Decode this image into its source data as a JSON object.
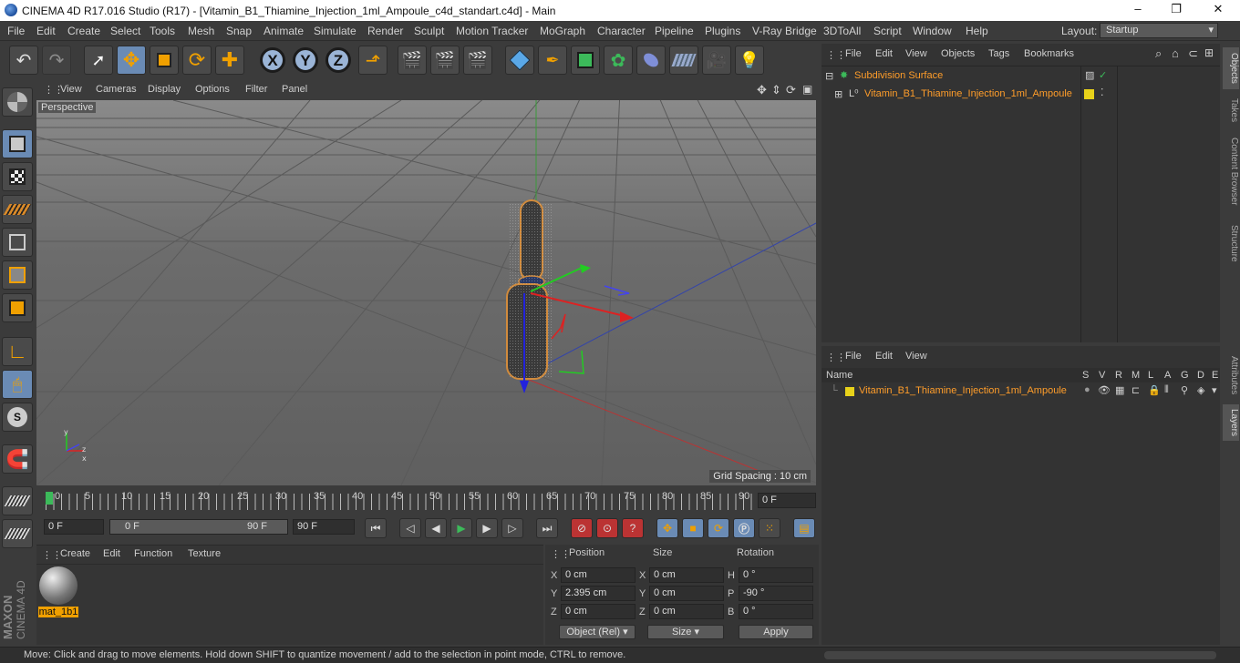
{
  "window": {
    "title": "CINEMA 4D R17.016 Studio (R17) - [Vitamin_B1_Thiamine_Injection_1ml_Ampoule_c4d_standart.c4d] - Main",
    "minimize": "–",
    "maximize": "❐",
    "close": "✕"
  },
  "menu": [
    "File",
    "Edit",
    "Create",
    "Select",
    "Tools",
    "Mesh",
    "Snap",
    "Animate",
    "Simulate",
    "Render",
    "Sculpt",
    "Motion Tracker",
    "MoGraph",
    "Character",
    "Pipeline",
    "Plugins",
    "V-Ray Bridge",
    "3DToAll",
    "Script",
    "Window",
    "Help"
  ],
  "layout": {
    "label": "Layout:",
    "value": "Startup"
  },
  "toolbar": {
    "axis_x": "X",
    "axis_y": "Y",
    "axis_z": "Z"
  },
  "viewport": {
    "menu": [
      "View",
      "Cameras",
      "Display",
      "Options",
      "Filter",
      "Panel"
    ],
    "label": "Perspective",
    "grid_spacing": "Grid Spacing : 10 cm"
  },
  "timeline": {
    "ticks": [
      "0",
      "5",
      "10",
      "15",
      "20",
      "25",
      "30",
      "35",
      "40",
      "45",
      "50",
      "55",
      "60",
      "65",
      "70",
      "75",
      "80",
      "85",
      "90"
    ],
    "frame_field": "0 F"
  },
  "playback": {
    "start": "0 F",
    "range_start": "0 F",
    "range_end": "90 F",
    "end": "90 F"
  },
  "material": {
    "menu": [
      "Create",
      "Edit",
      "Function",
      "Texture"
    ],
    "name": "mat_1b1"
  },
  "coords": {
    "headers": {
      "position": "Position",
      "size": "Size",
      "rotation": "Rotation"
    },
    "rows": [
      {
        "axis": "X",
        "pos": "0 cm",
        "size_axis": "X",
        "size": "0 cm",
        "rot_axis": "H",
        "rot": "0 °"
      },
      {
        "axis": "Y",
        "pos": "2.395 cm",
        "size_axis": "Y",
        "size": "0 cm",
        "rot_axis": "P",
        "rot": "-90 °"
      },
      {
        "axis": "Z",
        "pos": "0 cm",
        "size_axis": "Z",
        "size": "0 cm",
        "rot_axis": "B",
        "rot": "0 °"
      }
    ],
    "mode": "Object (Rel)",
    "size_mode": "Size",
    "apply": "Apply"
  },
  "objects": {
    "menu": [
      "File",
      "Edit",
      "View",
      "Objects",
      "Tags",
      "Bookmarks"
    ],
    "items": [
      {
        "name": "Subdivision Surface"
      },
      {
        "name": "Vitamin_B1_Thiamine_Injection_1ml_Ampoule"
      }
    ]
  },
  "layers": {
    "menu": [
      "File",
      "Edit",
      "View"
    ],
    "name_header": "Name",
    "cols": [
      "S",
      "V",
      "R",
      "M",
      "L",
      "A",
      "G",
      "D",
      "E"
    ],
    "item": "Vitamin_B1_Thiamine_Injection_1ml_Ampoule"
  },
  "right_tabs": [
    "Objects",
    "Takes",
    "Content Browser",
    "Structure",
    "Attributes",
    "Layers"
  ],
  "brand": {
    "maxon": "MAXON",
    "c4d": "CINEMA 4D"
  },
  "status": "Move: Click and drag to move elements. Hold down SHIFT to quantize movement / add to the selection in point mode, CTRL to remove.",
  "colors": {
    "accent": "#6a8bb5",
    "selected_text": "#ff9d2a",
    "layer_color": "#e8d21a"
  }
}
